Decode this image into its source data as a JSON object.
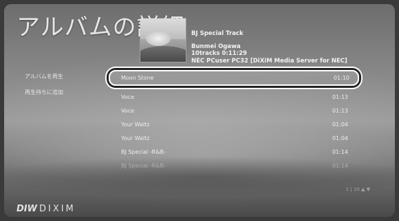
{
  "header": {
    "title": "アルバムの詳細"
  },
  "album": {
    "track_title": "BJ Special Track",
    "artist": "Bunmei Ogawa",
    "info": "10tracks  0:11:29",
    "extra": "NEC PCuser PC32 [DiXiM Media Server for NEC]"
  },
  "sidebar": {
    "items": [
      {
        "label": "アルバムを再生"
      },
      {
        "label": "再生待ちに追加"
      }
    ]
  },
  "tracks": [
    {
      "name": "Moon Stone",
      "time": "01:10"
    },
    {
      "name": "Voce",
      "time": "01:13"
    },
    {
      "name": "Voce",
      "time": "01:13"
    },
    {
      "name": "Your Waltz",
      "time": "01:04"
    },
    {
      "name": "Your Waltz",
      "time": "01:04"
    },
    {
      "name": "BJ Special -R&B-",
      "time": "01:14"
    },
    {
      "name": "BJ Special -R&B-",
      "time": "01:14"
    }
  ],
  "pager": {
    "text": "1 | 10   ▲ ▼"
  },
  "brand": {
    "mark": "DIW",
    "name": "DIXIM"
  }
}
